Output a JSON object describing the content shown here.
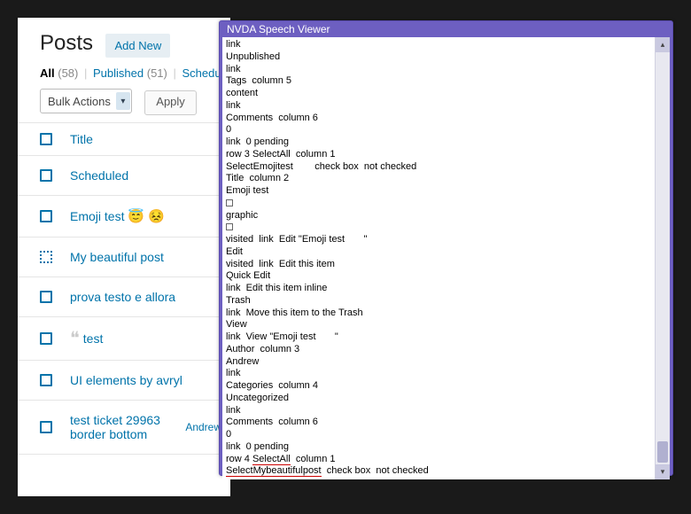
{
  "wp": {
    "page_title": "Posts",
    "add_new": "Add New",
    "filters": {
      "all_label": "All",
      "all_count": "(58)",
      "published_label": "Published",
      "published_count": "(51)",
      "scheduled_label": "Schedu"
    },
    "bulk_actions": "Bulk Actions",
    "apply": "Apply",
    "column_title": "Title",
    "rows": [
      {
        "title": "Scheduled"
      },
      {
        "title": "Emoji test ",
        "emoji": "😇 😣"
      },
      {
        "title": "My beautiful post",
        "focused": true
      },
      {
        "title": "prova testo e allora"
      },
      {
        "title": "test",
        "quote": true
      },
      {
        "title": "UI elements by avryl"
      },
      {
        "title": "test ticket 29963 border bottom",
        "author": "Andrew"
      }
    ]
  },
  "nvda": {
    "title": "NVDA Speech Viewer",
    "lines": [
      "link",
      "Unpublished",
      "link",
      "Tags  column 5",
      "content",
      "link",
      "Comments  column 6",
      "0",
      "link  0 pending",
      "row 3 SelectAll  column 1",
      "SelectEmojitest        check box  not checked",
      "Title  column 2",
      "Emoji test",
      "□",
      "graphic",
      "",
      "□",
      "visited  link  Edit \"Emoji test       \"",
      "Edit",
      "visited  link  Edit this item",
      "Quick Edit",
      "link  Edit this item inline",
      "Trash",
      "link  Move this item to the Trash",
      "View",
      "link  View \"Emoji test       \"",
      "Author  column 3",
      "Andrew",
      "link",
      "Categories  column 4",
      "Uncategorized",
      "link",
      "Comments  column 6",
      "0",
      "link  0 pending"
    ],
    "redline1_pre": "row 4 ",
    "redline1_word": "SelectAll",
    "redline1_post": "  column 1",
    "redline2_word": "SelectMybeautifulpost",
    "redline2_post": "  check box  not checked"
  }
}
